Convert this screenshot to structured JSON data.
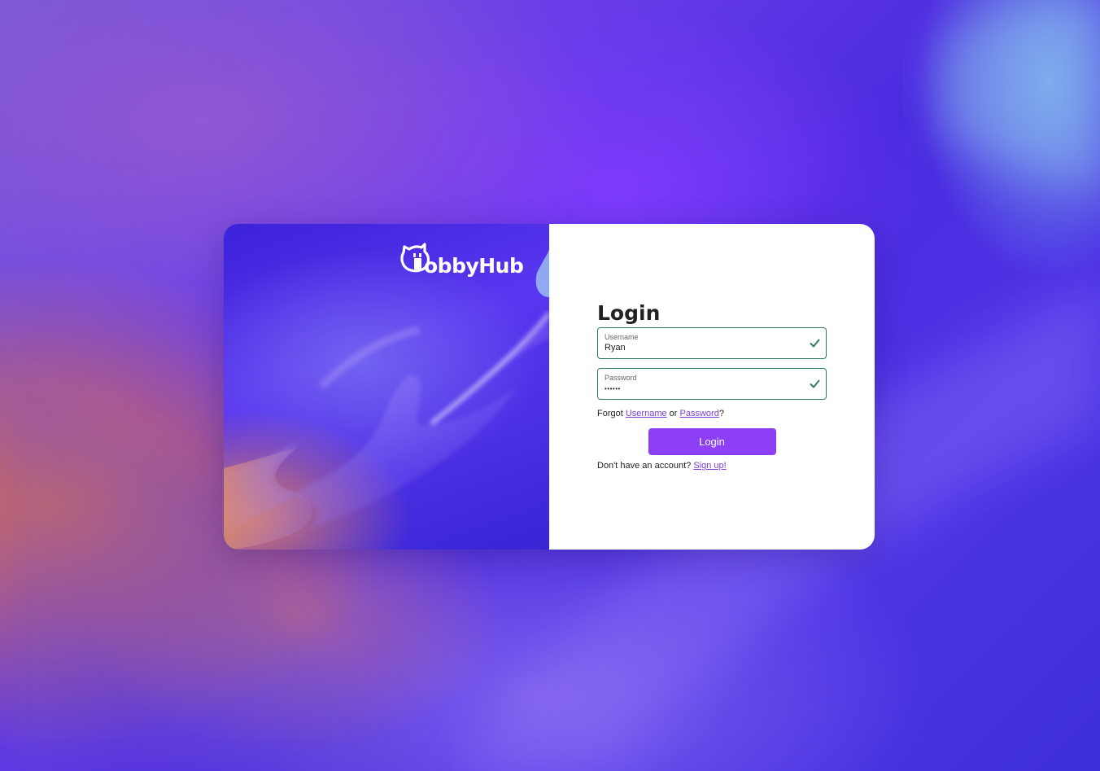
{
  "brand": {
    "name": "HobbyHub",
    "logo_text": "obbyHub"
  },
  "login": {
    "title": "Login",
    "username": {
      "label": "Username",
      "value": "Ryan",
      "valid": true
    },
    "password": {
      "label": "Password",
      "value": "••••••",
      "valid": true
    },
    "forgot_prefix": "Forgot",
    "forgot_username_link": "Username",
    "forgot_or": "or",
    "forgot_password_link": "Password",
    "forgot_suffix": "?",
    "submit_label": "Login",
    "signup_prompt": "Don't have an account?",
    "signup_link": "Sign up!"
  },
  "colors": {
    "accent": "#8c3ff5",
    "valid_border": "#2e7d5b",
    "link": "#7a3fd6"
  },
  "icons": {
    "logo": "hobbyhub-pig-icon",
    "field_status": "check-icon"
  }
}
